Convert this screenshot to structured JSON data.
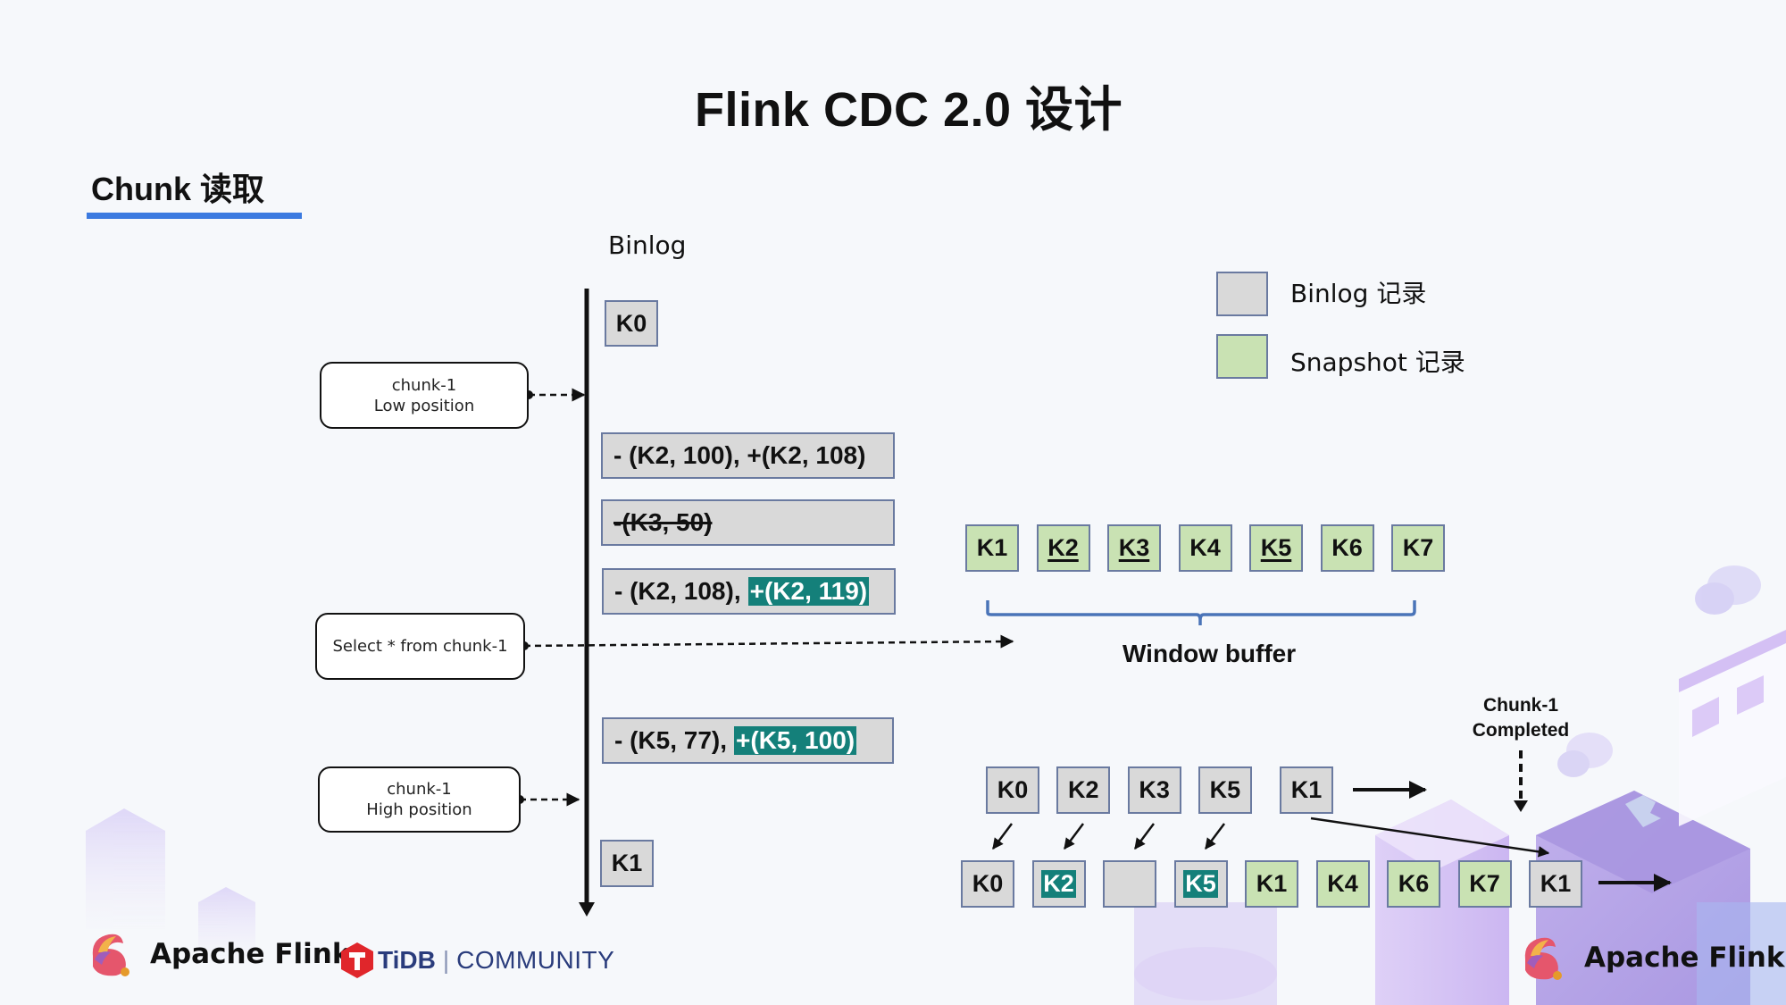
{
  "slide": {
    "title": "Flink CDC 2.0 设计",
    "section_title": "Chunk 读取"
  },
  "binlog": {
    "label": "Binlog",
    "events": [
      {
        "kind": "key",
        "text": "K0"
      },
      {
        "kind": "change",
        "plain": "- (K2, 100), +(K2, 108)",
        "highlight": ""
      },
      {
        "kind": "delete",
        "plain": "-(K3, 50)",
        "highlight": ""
      },
      {
        "kind": "change",
        "plain": "- (K2, 108),",
        "highlight": "+(K2, 119)"
      },
      {
        "kind": "change",
        "plain": "- (K5, 77),",
        "highlight": "+(K5, 100)"
      },
      {
        "kind": "key",
        "text": "K1"
      }
    ]
  },
  "markers": {
    "low": {
      "line1": "chunk-1",
      "line2": "Low position"
    },
    "select": {
      "line1": "Select * from chunk-1"
    },
    "high": {
      "line1": "chunk-1",
      "line2": "High position"
    }
  },
  "legend": {
    "binlog_label": "Binlog 记录",
    "snapshot_label": "Snapshot 记录",
    "binlog_color": "#d9d9d9",
    "snapshot_color": "#c9e2b3"
  },
  "window_buffer": {
    "label": "Window buffer",
    "keys": [
      {
        "text": "K1",
        "underline": false
      },
      {
        "text": "K2",
        "underline": true
      },
      {
        "text": "K3",
        "underline": true
      },
      {
        "text": "K4",
        "underline": false
      },
      {
        "text": "K5",
        "underline": true
      },
      {
        "text": "K6",
        "underline": false
      },
      {
        "text": "K7",
        "underline": false
      }
    ]
  },
  "merge": {
    "binlog_row": [
      "K0",
      "K2",
      "K3",
      "K5",
      "K1"
    ],
    "output_row": [
      {
        "text": "K0",
        "type": "binlog",
        "highlight": false
      },
      {
        "text": "K2",
        "type": "binlog",
        "highlight": true
      },
      {
        "text": "",
        "type": "binlog",
        "highlight": false
      },
      {
        "text": "K5",
        "type": "binlog",
        "highlight": true
      },
      {
        "text": "K1",
        "type": "snapshot",
        "highlight": false
      },
      {
        "text": "K4",
        "type": "snapshot",
        "highlight": false
      },
      {
        "text": "K6",
        "type": "snapshot",
        "highlight": false
      },
      {
        "text": "K7",
        "type": "snapshot",
        "highlight": false
      },
      {
        "text": "K1",
        "type": "binlog",
        "highlight": false
      }
    ],
    "completed_line1": "Chunk-1",
    "completed_line2": "Completed"
  },
  "footer": {
    "flink_logo_text": "Apache Flink",
    "tidb_text": "TiDB",
    "tidb_separator": "|",
    "community_text": "COMMUNITY",
    "flink_logo_text_right": "Apache Flink"
  },
  "colors": {
    "accent_blue": "#3b7ae0",
    "highlight_teal": "#14807a",
    "tidb_red": "#e0262b",
    "brace_blue": "#4a74b8"
  }
}
